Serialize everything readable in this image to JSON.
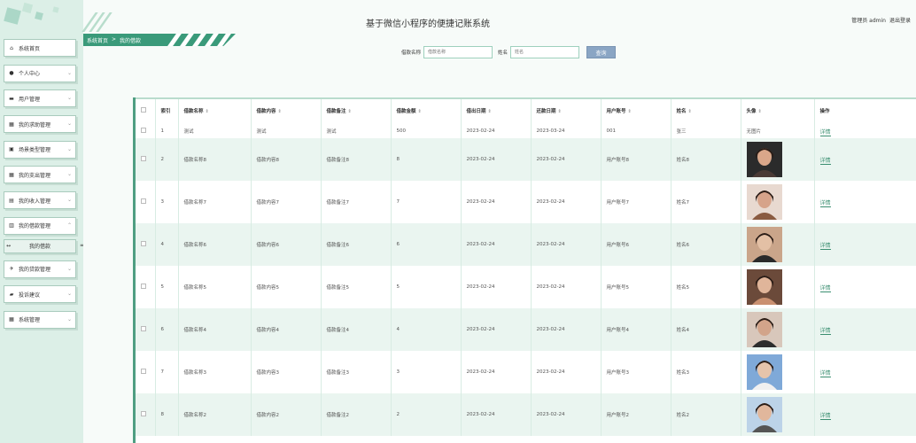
{
  "app": {
    "title": "基于微信小程序的便捷记账系统",
    "user_role": "管理员 admin",
    "logout_label": "退出登录"
  },
  "breadcrumb": {
    "home": "系统首页",
    "sep": ">",
    "current": "我的借款"
  },
  "sidebar": {
    "items": [
      {
        "icon": "home-icon",
        "glyph": "⌂",
        "label": "系统首页",
        "chevron": ""
      },
      {
        "icon": "user-icon",
        "glyph": "●",
        "label": "个人中心",
        "chevron": "⌄"
      },
      {
        "icon": "briefcase-icon",
        "glyph": "▬",
        "label": "用户管理",
        "chevron": "⌄"
      },
      {
        "icon": "grid-icon",
        "glyph": "▦",
        "label": "我的求助管理",
        "chevron": "⌄"
      },
      {
        "icon": "card-icon",
        "glyph": "▣",
        "label": "场景类型管理",
        "chevron": "⌄"
      },
      {
        "icon": "grid-icon",
        "glyph": "▦",
        "label": "我的支出管理",
        "chevron": "⌄"
      },
      {
        "icon": "doc-icon",
        "glyph": "▤",
        "label": "我的收入管理",
        "chevron": "⌄"
      },
      {
        "icon": "bag-icon",
        "glyph": "▥",
        "label": "我的借款管理",
        "chevron": "⌃"
      }
    ],
    "sub_item": {
      "label": "我的借款",
      "arrows_left": "↔",
      "arrows_right": "═"
    },
    "items_after": [
      {
        "icon": "plane-icon",
        "glyph": "✈",
        "label": "我的贷款管理",
        "chevron": "⌄"
      },
      {
        "icon": "folder-icon",
        "glyph": "▰",
        "label": "投诉建议",
        "chevron": "⌄"
      },
      {
        "icon": "grid-icon",
        "glyph": "▦",
        "label": "系统管理",
        "chevron": "⌄"
      }
    ]
  },
  "search": {
    "name_label": "借款名称",
    "name_placeholder": "借款名称",
    "person_label": "姓名",
    "person_placeholder": "姓名",
    "button_label": "查询"
  },
  "table": {
    "columns": [
      "索引",
      "借款名称",
      "借款内容",
      "借款备注",
      "借款金额",
      "借出日期",
      "还款日期",
      "用户账号",
      "姓名",
      "头像",
      "操作"
    ],
    "first_row": {
      "index": "1",
      "name": "测试",
      "content": "测试",
      "remark": "测试",
      "amount": "500",
      "out_date": "2023-02-24",
      "repay_date": "2023-03-24",
      "account": "001",
      "person": "张三",
      "avatar": "无图片",
      "action": "详情"
    },
    "rows": [
      {
        "index": "2",
        "name": "借款名称8",
        "content": "借款内容8",
        "remark": "借款备注8",
        "amount": "8",
        "out_date": "2023-02-24",
        "repay_date": "2023-02-24",
        "account": "用户账号8",
        "person": "姓名8",
        "action": "详情"
      },
      {
        "index": "3",
        "name": "借款名称7",
        "content": "借款内容7",
        "remark": "借款备注7",
        "amount": "7",
        "out_date": "2023-02-24",
        "repay_date": "2023-02-24",
        "account": "用户账号7",
        "person": "姓名7",
        "action": "详情"
      },
      {
        "index": "4",
        "name": "借款名称6",
        "content": "借款内容6",
        "remark": "借款备注6",
        "amount": "6",
        "out_date": "2023-02-24",
        "repay_date": "2023-02-24",
        "account": "用户账号6",
        "person": "姓名6",
        "action": "详情"
      },
      {
        "index": "5",
        "name": "借款名称5",
        "content": "借款内容5",
        "remark": "借款备注5",
        "amount": "5",
        "out_date": "2023-02-24",
        "repay_date": "2023-02-24",
        "account": "用户账号5",
        "person": "姓名5",
        "action": "详情"
      },
      {
        "index": "6",
        "name": "借款名称4",
        "content": "借款内容4",
        "remark": "借款备注4",
        "amount": "4",
        "out_date": "2023-02-24",
        "repay_date": "2023-02-24",
        "account": "用户账号4",
        "person": "姓名4",
        "action": "详情"
      },
      {
        "index": "7",
        "name": "借款名称3",
        "content": "借款内容3",
        "remark": "借款备注3",
        "amount": "3",
        "out_date": "2023-02-24",
        "repay_date": "2023-02-24",
        "account": "用户账号3",
        "person": "姓名3",
        "action": "详情"
      },
      {
        "index": "8",
        "name": "借款名称2",
        "content": "借款内容2",
        "remark": "借款备注2",
        "amount": "2",
        "out_date": "2023-02-24",
        "repay_date": "2023-02-24",
        "account": "用户账号2",
        "person": "姓名2",
        "action": "详情"
      }
    ]
  },
  "theme": {
    "accent": "#3a9a7a",
    "sidebar_bg": "#dcefe7",
    "row_alt": "#eaf5f0",
    "button": "#8aa5c4"
  }
}
